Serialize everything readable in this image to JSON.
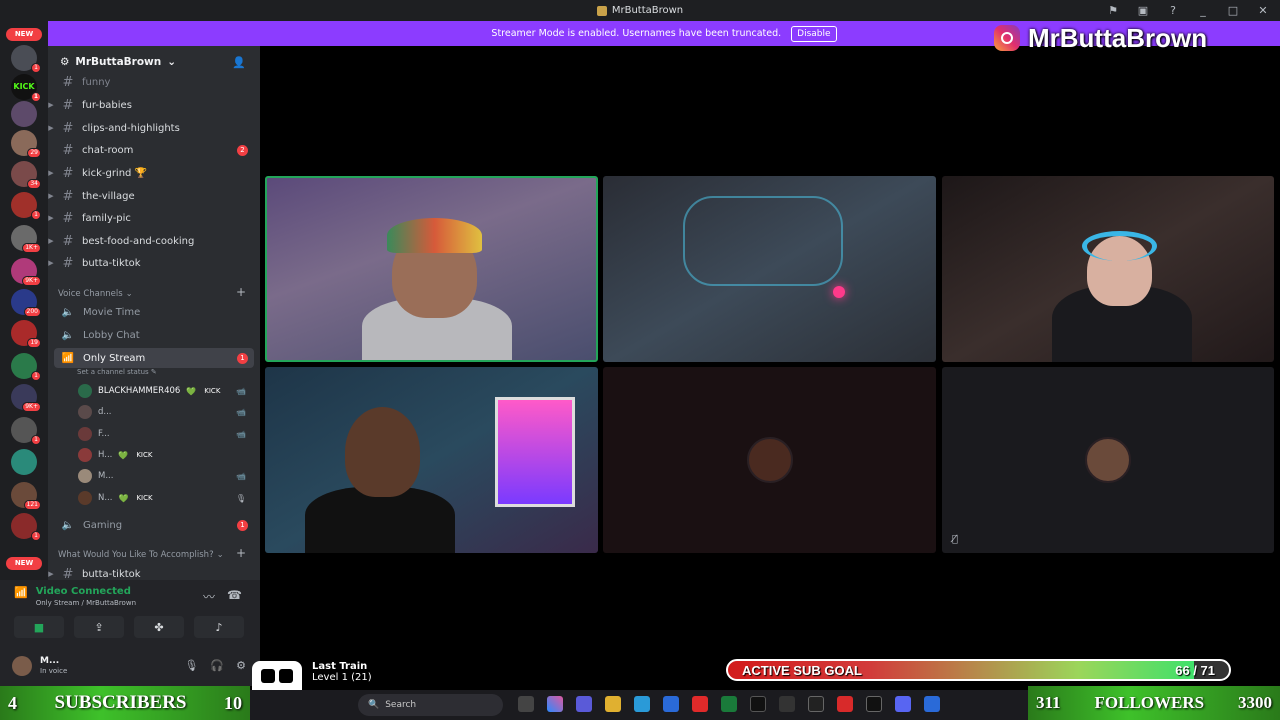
{
  "window": {
    "title": "MrButtaBrown",
    "controls": [
      "_",
      "□",
      "✕"
    ]
  },
  "streamer_mode": {
    "message": "Streamer Mode is enabled. Usernames have been truncated.",
    "button": "Disable"
  },
  "overlay": {
    "instagram_handle": "MrButtaBrown"
  },
  "server_rail": {
    "new_top": "NEW",
    "new_bottom": "NEW",
    "badges": [
      "1",
      "1",
      "29",
      "34",
      "1",
      "1K+",
      "9K+",
      "200",
      "19",
      "1",
      "9K+",
      "1",
      "121",
      "1"
    ]
  },
  "guild": {
    "name": "MrButtaBrown",
    "text_channels": [
      {
        "name": "funny",
        "badge": ""
      },
      {
        "name": "fur-babies",
        "badge": ""
      },
      {
        "name": "clips-and-highlights",
        "badge": ""
      },
      {
        "name": "chat-room",
        "badge": "2"
      },
      {
        "name": "kick-grind 🏆",
        "badge": ""
      },
      {
        "name": "the-village",
        "badge": ""
      },
      {
        "name": "family-pic",
        "badge": ""
      },
      {
        "name": "best-food-and-cooking",
        "badge": ""
      },
      {
        "name": "butta-tiktok",
        "badge": ""
      }
    ],
    "voice_category": "Voice Channels",
    "voice_channels": [
      {
        "name": "Movie Time",
        "badge": ""
      },
      {
        "name": "Lobby Chat",
        "badge": ""
      },
      {
        "name": "Only Stream",
        "badge": "1"
      }
    ],
    "channel_status": "Set a channel status",
    "members": [
      {
        "name": "BLACKHAMMER406",
        "tag": "KICK",
        "media": "📹"
      },
      {
        "name": "d...",
        "tag": "",
        "media": "📹"
      },
      {
        "name": "F...",
        "tag": "",
        "media": "📹"
      },
      {
        "name": "H...",
        "tag": "KICK",
        "media": ""
      },
      {
        "name": "M...",
        "tag": "",
        "media": "📹"
      },
      {
        "name": "N...",
        "tag": "KICK",
        "media": "🎙"
      }
    ],
    "gaming_channel": {
      "name": "Gaming",
      "badge": "1"
    },
    "second_category": "What Would You Like To Accomplish?",
    "bottom_channel": "butta-tiktok"
  },
  "connection": {
    "title": "Video Connected",
    "subtitle": "Only Stream / MrButtaBrown"
  },
  "user": {
    "name": "M...",
    "status": "In voice"
  },
  "music": {
    "title": "Last Train",
    "level": "Level 1 (21)"
  },
  "sub_goal": {
    "label": "ACTIVE SUB GOAL",
    "current": "66",
    "target": "71",
    "progress": 0.93
  },
  "subscribers": {
    "left_num": "4",
    "label": "SUBSCRIBERS",
    "right_num": "10"
  },
  "followers": {
    "left_num": "311",
    "label": "FOLLOWERS",
    "right_num": "3300"
  },
  "taskbar": {
    "search_placeholder": "Search"
  },
  "colors": {
    "accent": "#8c3cff",
    "speaking": "#23a55a",
    "badge": "#f23f43",
    "kick": "#53fc18"
  }
}
